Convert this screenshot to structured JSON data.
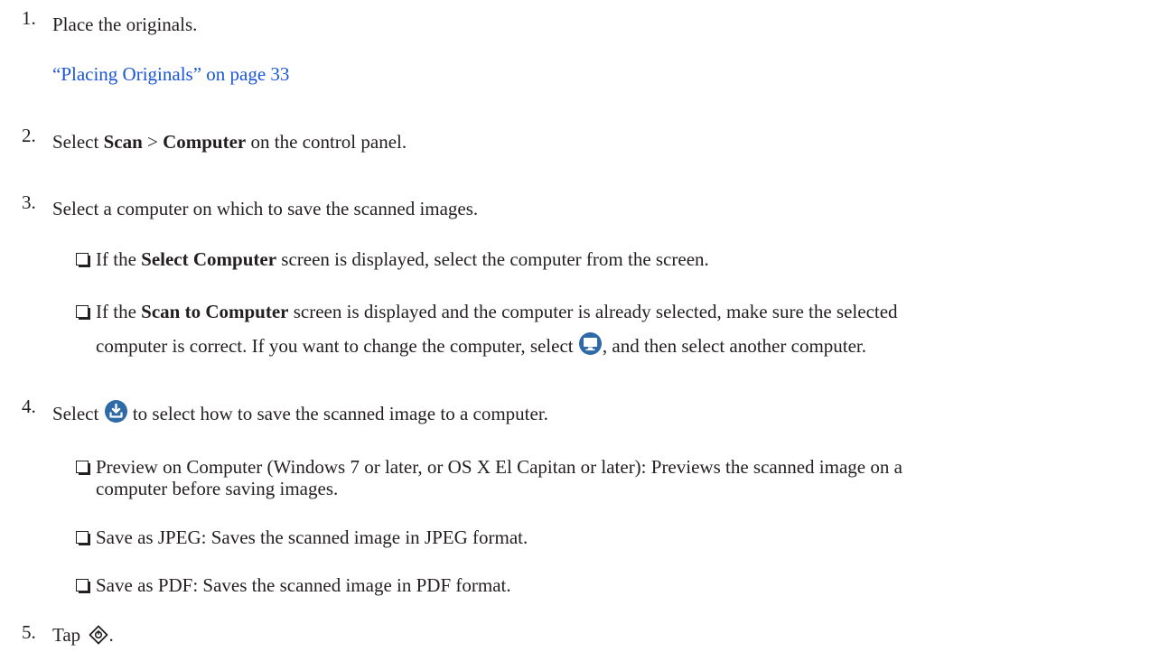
{
  "steps": [
    {
      "num": "1.",
      "text": "Place the originals.",
      "link": "“Placing Originals” on page 33"
    },
    {
      "num": "2.",
      "pre": "Select ",
      "b1": "Scan",
      "mid": " > ",
      "b2": "Computer",
      "post": " on the control panel."
    },
    {
      "num": "3.",
      "text": "Select a computer on which to save the scanned images.",
      "bullets": [
        {
          "pre": "If the ",
          "bold": "Select Computer",
          "post": " screen is displayed, select the computer from the screen."
        },
        {
          "pre": "If the ",
          "bold": "Scan to Computer",
          "post": " screen is displayed and the computer is already selected, make sure the selected",
          "cont_pre": "computer is correct. If you want to change the computer, select ",
          "cont_post": ", and then select another computer."
        }
      ]
    },
    {
      "num": "4.",
      "pre": "Select ",
      "post": " to select how to save the scanned image to a computer.",
      "bullets": [
        {
          "line1": "Preview on Computer (Windows 7 or later, or OS X El Capitan or later): Previews the scanned image on a",
          "line2": "computer before saving images."
        },
        {
          "text": "Save as JPEG: Saves the scanned image in JPEG format."
        },
        {
          "text": "Save as PDF: Saves the scanned image in PDF format."
        }
      ]
    },
    {
      "num": "5.",
      "pre": "Tap ",
      "post": "."
    }
  ],
  "icons": {
    "computer": "computer-monitor-icon",
    "save": "save-download-icon",
    "start": "start-diamond-icon",
    "icon_color": "#2e6aa6"
  },
  "colors": {
    "link": "#1a55d6",
    "text": "#231f20"
  }
}
